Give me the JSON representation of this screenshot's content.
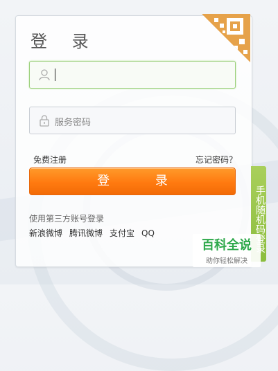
{
  "login": {
    "title": "登 录",
    "username": {
      "value": "",
      "placeholder": ""
    },
    "password": {
      "placeholder": "服务密码"
    },
    "register_link": "免费注册",
    "forgot_link": "忘记密码？",
    "submit_label": "登 录"
  },
  "third_party": {
    "label": "使用第三方账号登录",
    "providers": [
      "新浪微博",
      "腾讯微博",
      "支付宝",
      "QQ"
    ]
  },
  "side_tab": {
    "label": "手机随机码登录"
  },
  "watermark": {
    "title": "百科全说",
    "subtitle": "助你轻松解决"
  },
  "colors": {
    "accent_orange": "#ff7a10",
    "accent_green": "#9bd07c",
    "qr_corner": "#e6a24a"
  },
  "icons": [
    "user-icon",
    "lock-icon",
    "qr-code-icon"
  ]
}
